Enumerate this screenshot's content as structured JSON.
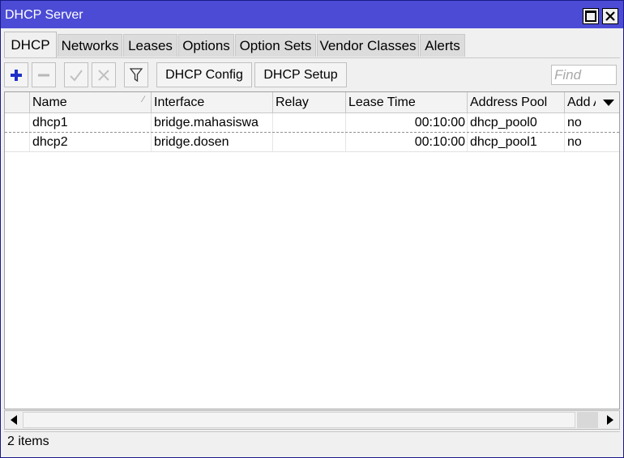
{
  "window": {
    "title": "DHCP Server"
  },
  "tabs": [
    {
      "label": "DHCP",
      "active": true
    },
    {
      "label": "Networks"
    },
    {
      "label": "Leases"
    },
    {
      "label": "Options"
    },
    {
      "label": "Option Sets"
    },
    {
      "label": "Vendor Classes"
    },
    {
      "label": "Alerts"
    }
  ],
  "toolbar": {
    "dhcp_config_label": "DHCP Config",
    "dhcp_setup_label": "DHCP Setup",
    "find_placeholder": "Find"
  },
  "table": {
    "columns": [
      "Name",
      "Interface",
      "Relay",
      "Lease Time",
      "Address Pool",
      "Add A"
    ],
    "rows": [
      {
        "name": "dhcp1",
        "interface": "bridge.mahasiswa",
        "relay": "",
        "lease_time": "00:10:00",
        "address_pool": "dhcp_pool0",
        "add_arp": "no"
      },
      {
        "name": "dhcp2",
        "interface": "bridge.dosen",
        "relay": "",
        "lease_time": "00:10:00",
        "address_pool": "dhcp_pool1",
        "add_arp": "no"
      }
    ]
  },
  "status": {
    "text": "2 items"
  },
  "colors": {
    "titlebar": "#4b4bd6",
    "add_icon": "#1f2fc8"
  }
}
